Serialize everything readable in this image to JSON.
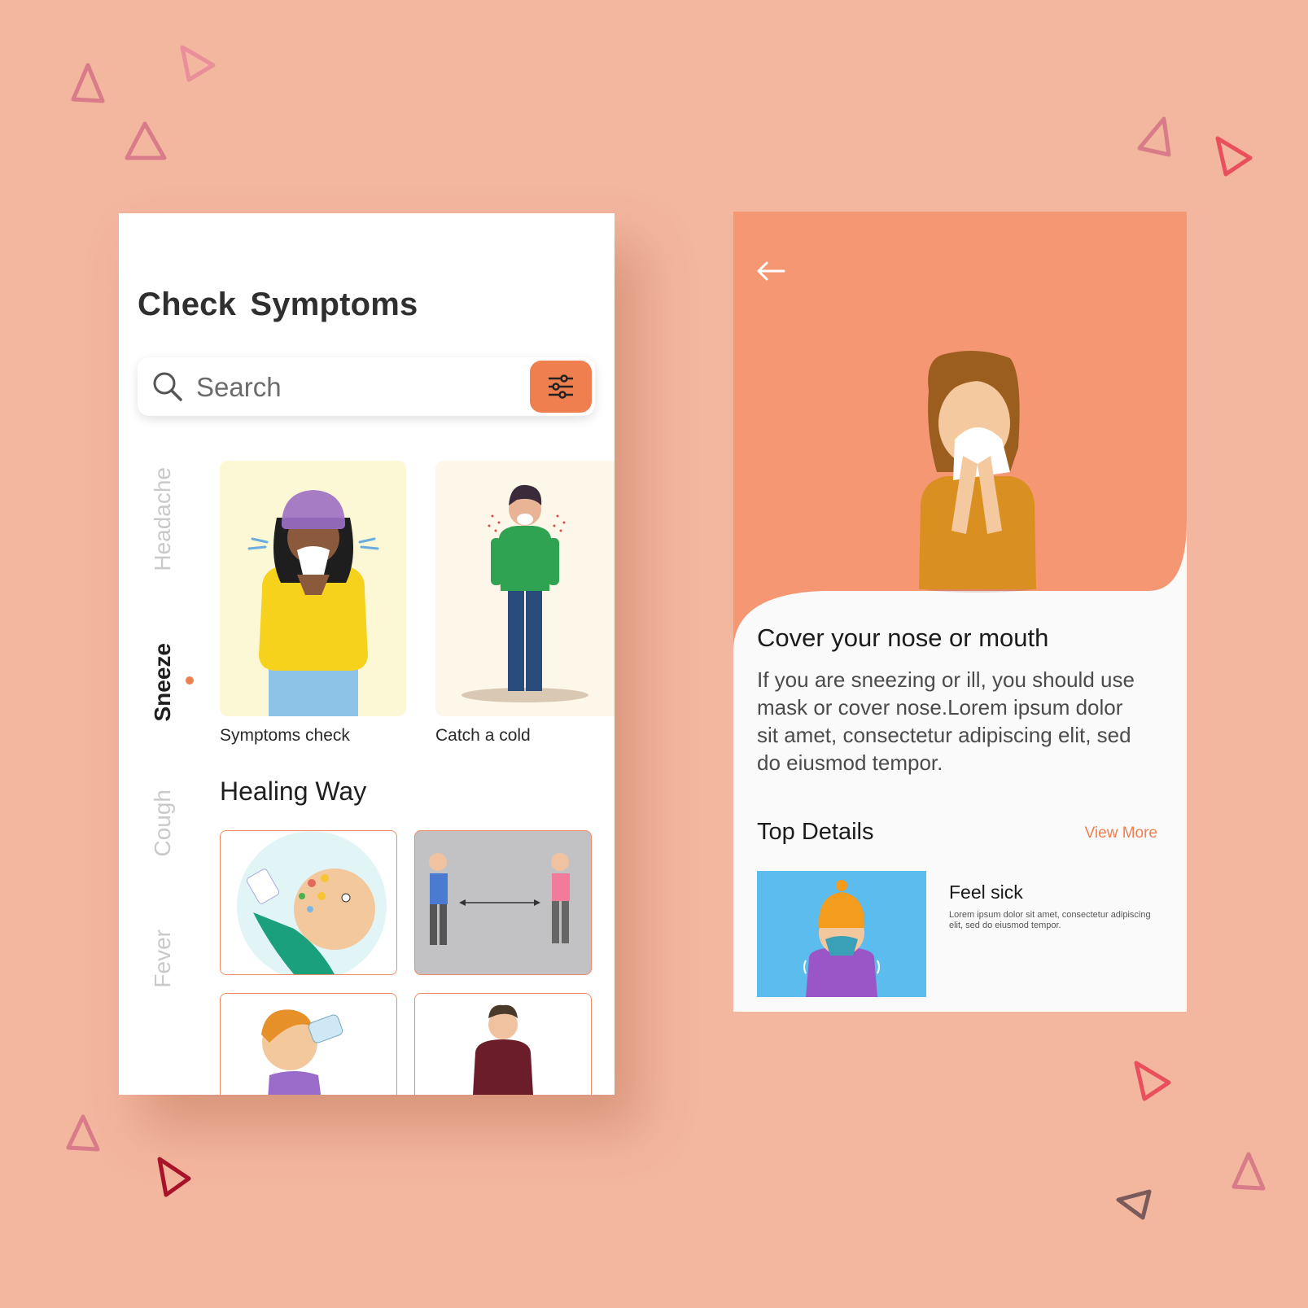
{
  "colors": {
    "background": "#f3b69e",
    "accent": "#f07f50",
    "hero": "#f49772",
    "card_border": "#f08a68"
  },
  "left_screen": {
    "title": "Check Symptoms",
    "search": {
      "placeholder": "Search",
      "icon": "search-icon",
      "filter_icon": "sliders-icon"
    },
    "side_tabs": [
      {
        "label": "Headache",
        "active": false
      },
      {
        "label": "Sneeze",
        "active": true
      },
      {
        "label": "Cough",
        "active": false
      },
      {
        "label": "Fever",
        "active": false
      }
    ],
    "cards": [
      {
        "label": "Symptoms check"
      },
      {
        "label": "Catch a cold"
      }
    ],
    "healing_title": "Healing Way"
  },
  "right_screen": {
    "back_icon": "arrow-left-icon",
    "title": "Cover your nose or mouth",
    "body": "If you are sneezing or ill, you should use mask or cover nose.Lorem ipsum dolor sit amet, consectetur adipiscing elit, sed do eiusmod tempor.",
    "section_title": "Top Details",
    "view_more": "View More",
    "detail": {
      "title": "Feel sick",
      "description": "Lorem ipsum dolor sit amet, consectetur adipiscing elit, sed do eiusmod tempor."
    }
  }
}
